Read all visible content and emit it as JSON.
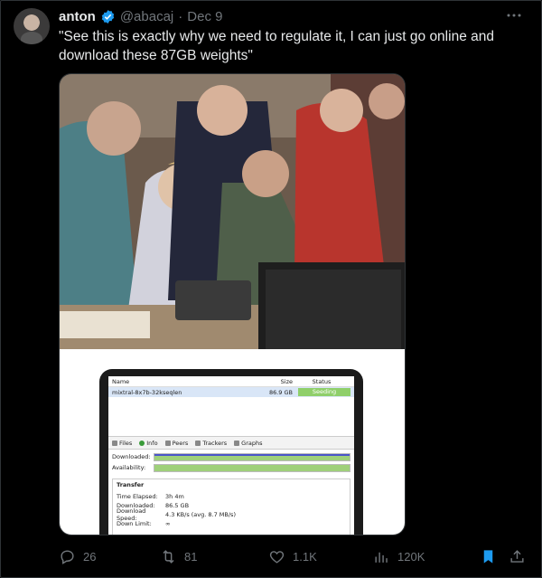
{
  "author": {
    "name": "anton",
    "handle": "@abacaj",
    "separator": "·",
    "date": "Dec 9"
  },
  "icons": {
    "verified": "verified-badge-icon",
    "more": "more-options-icon",
    "reply": "reply-icon",
    "retweet": "retweet-icon",
    "like": "like-icon",
    "views": "views-icon",
    "bookmark": "bookmark-icon",
    "share": "share-icon"
  },
  "colors": {
    "verified": "#1d9bf0",
    "bookmark": "#1d9bf0",
    "muted": "#71767b",
    "seeding": "#8fcf6a"
  },
  "tweet_text": "\"See this is exactly why we need to regulate it, I can just go online and download these 87GB weights\"",
  "torrent": {
    "headers": {
      "name": "Name",
      "size": "Size",
      "status": "Status"
    },
    "row": {
      "name": "mixtral-8x7b-32kseqlen",
      "size": "86.9 GB",
      "status": "Seeding"
    },
    "tabs": [
      "Files",
      "Info",
      "Peers",
      "Trackers",
      "Graphs"
    ],
    "downloaded_label": "Downloaded:",
    "availability_label": "Availability:",
    "downloaded_progress": 1.0,
    "availability_progress": 1.0,
    "transfer": {
      "title": "Transfer",
      "rows": [
        {
          "k": "Time Elapsed:",
          "v": "3h 4m"
        },
        {
          "k": "Downloaded:",
          "v": "86.5 GB"
        },
        {
          "k": "Download Speed:",
          "v": "4.3 KB/s (avg. 8.7 MB/s)"
        },
        {
          "k": "Down Limit:",
          "v": "∞"
        }
      ]
    }
  },
  "stats": {
    "replies": "26",
    "retweets": "81",
    "likes": "1.1K",
    "views": "120K"
  }
}
